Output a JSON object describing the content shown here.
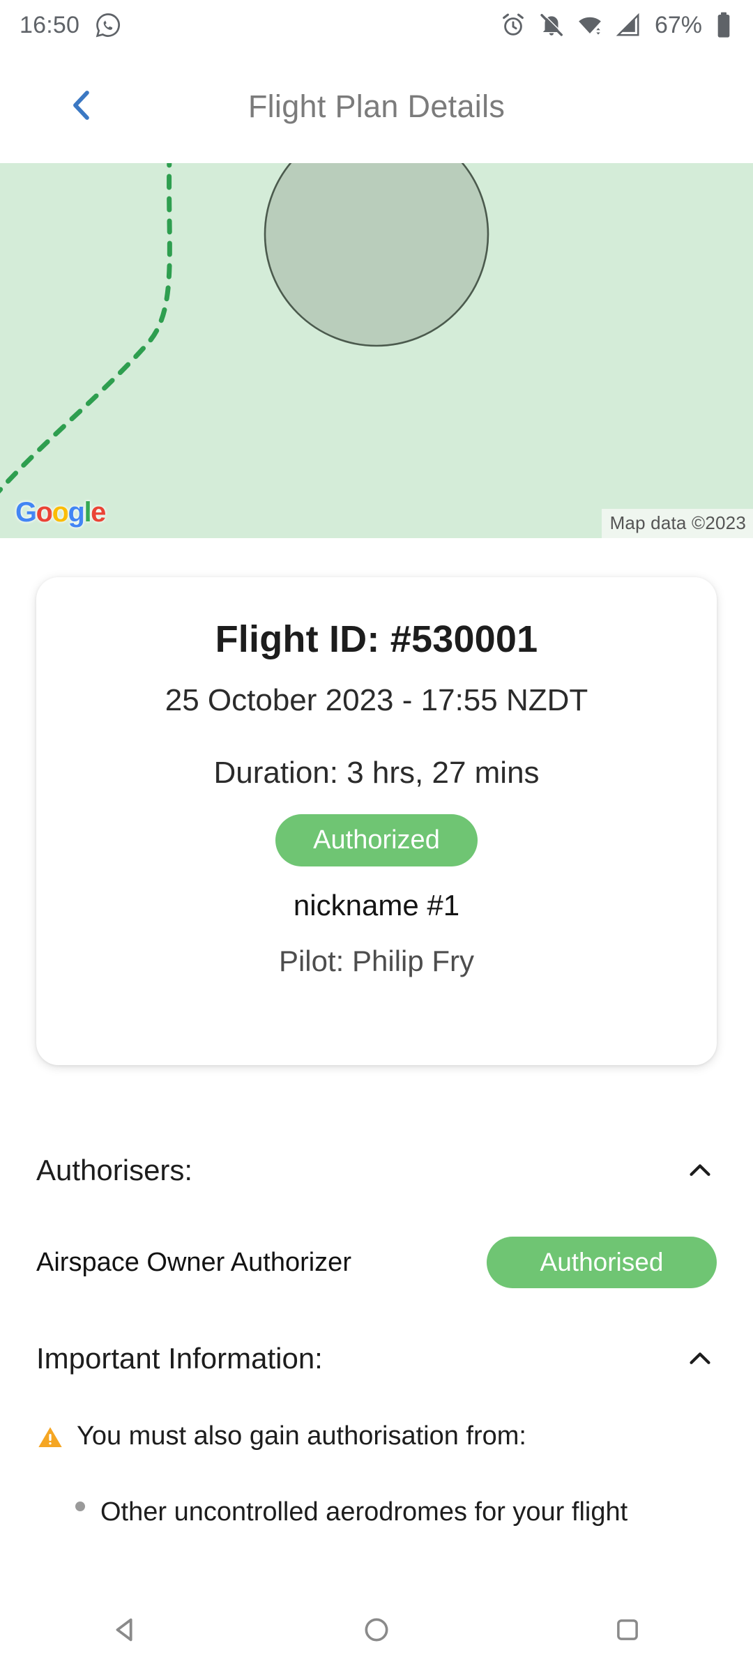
{
  "status_bar": {
    "time": "16:50",
    "battery_percent": "67%",
    "icons": [
      "whatsapp-icon",
      "alarm-icon",
      "notifications-off-icon",
      "wifi-icon",
      "cellular-signal-icon",
      "battery-icon"
    ]
  },
  "app_bar": {
    "back_label": "back-chevron",
    "title": "Flight Plan Details",
    "title_color": "#7b7b7b",
    "back_color": "#3b78c3"
  },
  "map": {
    "provider_logo": [
      "G",
      "o",
      "o",
      "g",
      "l",
      "e"
    ],
    "attribution": "Map data ©2023",
    "background_color": "#d4ecd8",
    "zone_fill": "#b9cdbb",
    "zone_stroke": "#4b5a4d",
    "trail_color": "#2e9e4f"
  },
  "flight_card": {
    "flight_id": "Flight ID: #530001",
    "datetime": "25 October 2023 - 17:55 NZDT",
    "duration": "Duration: 3 hrs, 27 mins",
    "status": "Authorized",
    "status_color": "#6fc573",
    "nickname": "nickname #1",
    "pilot": "Pilot: Philip Fry"
  },
  "authorisers": {
    "title": "Authorisers:",
    "collapse_icon": "chevron-up-icon",
    "rows": [
      {
        "name": "Airspace Owner Authorizer",
        "status": "Authorised",
        "status_color": "#6fc573"
      }
    ]
  },
  "important_information": {
    "title": "Important Information:",
    "collapse_icon": "chevron-up-icon",
    "warning_icon": "warning-triangle-icon",
    "warning_color": "#F5A623",
    "warning_text": "You must also gain authorisation from:",
    "bullets": [
      "Other uncontrolled aerodromes for your flight"
    ]
  },
  "nav_bar": {
    "back": "back-triangle-icon",
    "home": "home-circle-icon",
    "recents": "recents-square-icon"
  }
}
